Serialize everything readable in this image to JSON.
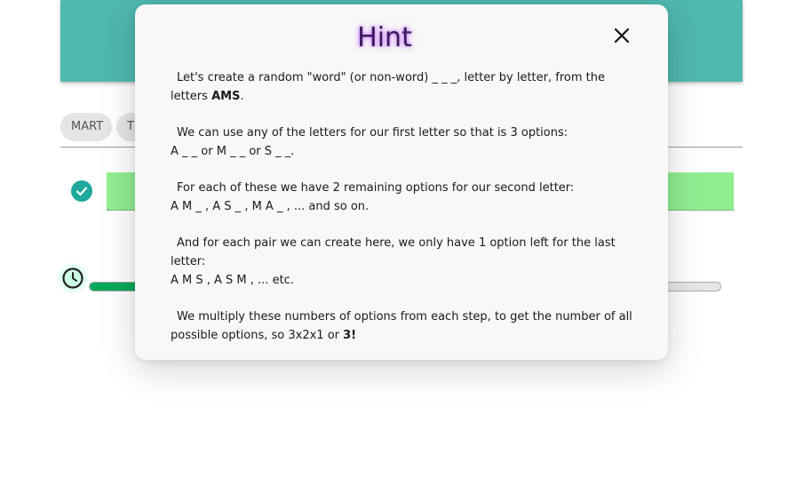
{
  "tabs": [
    {
      "label": "MART"
    },
    {
      "label": "TI"
    }
  ],
  "progress": {
    "fraction": 0.08
  },
  "colors": {
    "banner": "#4fb8af",
    "answer_bg": "#90ee90",
    "check": "#1fa89c",
    "progress_fill": "#08a85a",
    "hint_glow": "#be50ff"
  },
  "icons": {
    "close": "close-icon",
    "check": "check-circle-icon",
    "clock": "clock-icon"
  },
  "hint": {
    "title": "Hint",
    "p1_a": "Let's create a random \"word\" (or non-word) _ _ _, letter by letter, from the letters ",
    "p1_bold": "AMS",
    "p1_end": ".",
    "p2_a": "We can use any of the letters for our first letter so that is 3 options:",
    "p2_b": "A _ _ or M _ _ or S _ _.",
    "p3_a": "For each of these we have 2 remaining options for our second letter:",
    "p3_b": "A M _ , A S _ , M A _ , ... and so on.",
    "p4_a": "And for each pair we can create here, we only have 1 option left for the last letter:",
    "p4_b": "A M S , A S M , ... etc.",
    "p5_a": "We multiply these numbers of options from each step, to get the number of all possible options, so 3x2x1 or ",
    "p5_bold": "3!"
  }
}
